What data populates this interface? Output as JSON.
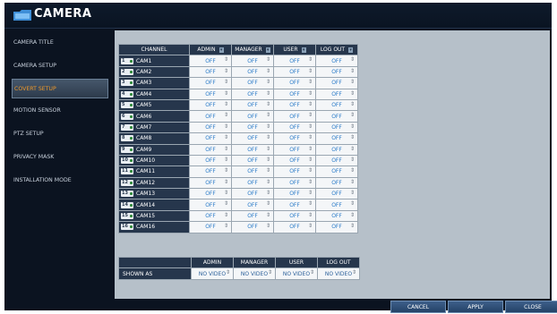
{
  "window": {
    "title": "CAMERA",
    "icon": "camera-folder-icon"
  },
  "sidebar": {
    "items": [
      {
        "label": "CAMERA TITLE",
        "active": false
      },
      {
        "label": "CAMERA SETUP",
        "active": false
      },
      {
        "label": "COVERT SETUP",
        "active": true
      },
      {
        "label": "MOTION SENSOR",
        "active": false
      },
      {
        "label": "PTZ SETUP",
        "active": false
      },
      {
        "label": "PRIVACY MASK",
        "active": false
      },
      {
        "label": "INSTALLATION MODE",
        "active": false
      }
    ]
  },
  "covert_table": {
    "headers": [
      "CHANNEL",
      "ADMIN",
      "MANAGER",
      "USER",
      "LOG OUT"
    ],
    "rows": [
      {
        "num": "1",
        "channel": "CAM1",
        "values": [
          "OFF",
          "OFF",
          "OFF",
          "OFF"
        ]
      },
      {
        "num": "2",
        "channel": "CAM2",
        "values": [
          "OFF",
          "OFF",
          "OFF",
          "OFF"
        ]
      },
      {
        "num": "3",
        "channel": "CAM3",
        "values": [
          "OFF",
          "OFF",
          "OFF",
          "OFF"
        ]
      },
      {
        "num": "4",
        "channel": "CAM4",
        "values": [
          "OFF",
          "OFF",
          "OFF",
          "OFF"
        ]
      },
      {
        "num": "5",
        "channel": "CAM5",
        "values": [
          "OFF",
          "OFF",
          "OFF",
          "OFF"
        ]
      },
      {
        "num": "6",
        "channel": "CAM6",
        "values": [
          "OFF",
          "OFF",
          "OFF",
          "OFF"
        ]
      },
      {
        "num": "7",
        "channel": "CAM7",
        "values": [
          "OFF",
          "OFF",
          "OFF",
          "OFF"
        ]
      },
      {
        "num": "8",
        "channel": "CAM8",
        "values": [
          "OFF",
          "OFF",
          "OFF",
          "OFF"
        ]
      },
      {
        "num": "9",
        "channel": "CAM9",
        "values": [
          "OFF",
          "OFF",
          "OFF",
          "OFF"
        ]
      },
      {
        "num": "10",
        "channel": "CAM10",
        "values": [
          "OFF",
          "OFF",
          "OFF",
          "OFF"
        ]
      },
      {
        "num": "11",
        "channel": "CAM11",
        "values": [
          "OFF",
          "OFF",
          "OFF",
          "OFF"
        ]
      },
      {
        "num": "12",
        "channel": "CAM12",
        "values": [
          "OFF",
          "OFF",
          "OFF",
          "OFF"
        ]
      },
      {
        "num": "13",
        "channel": "CAM13",
        "values": [
          "OFF",
          "OFF",
          "OFF",
          "OFF"
        ]
      },
      {
        "num": "14",
        "channel": "CAM14",
        "values": [
          "OFF",
          "OFF",
          "OFF",
          "OFF"
        ]
      },
      {
        "num": "15",
        "channel": "CAM15",
        "values": [
          "OFF",
          "OFF",
          "OFF",
          "OFF"
        ]
      },
      {
        "num": "16",
        "channel": "CAM16",
        "values": [
          "OFF",
          "OFF",
          "OFF",
          "OFF"
        ]
      }
    ]
  },
  "shown_table": {
    "headers": [
      "ADMIN",
      "MANAGER",
      "USER",
      "LOG OUT"
    ],
    "row_label": "SHOWN AS",
    "values": [
      "NO VIDEO",
      "NO VIDEO",
      "NO VIDEO",
      "NO VIDEO"
    ]
  },
  "footer": {
    "cancel": "CANCEL",
    "apply": "APPLY",
    "close": "CLOSE"
  },
  "colors": {
    "accent": "#f19a2a",
    "header_bg": "#26364c",
    "panel_bg": "#b6c0c9",
    "value_text": "#2a7bc9"
  }
}
